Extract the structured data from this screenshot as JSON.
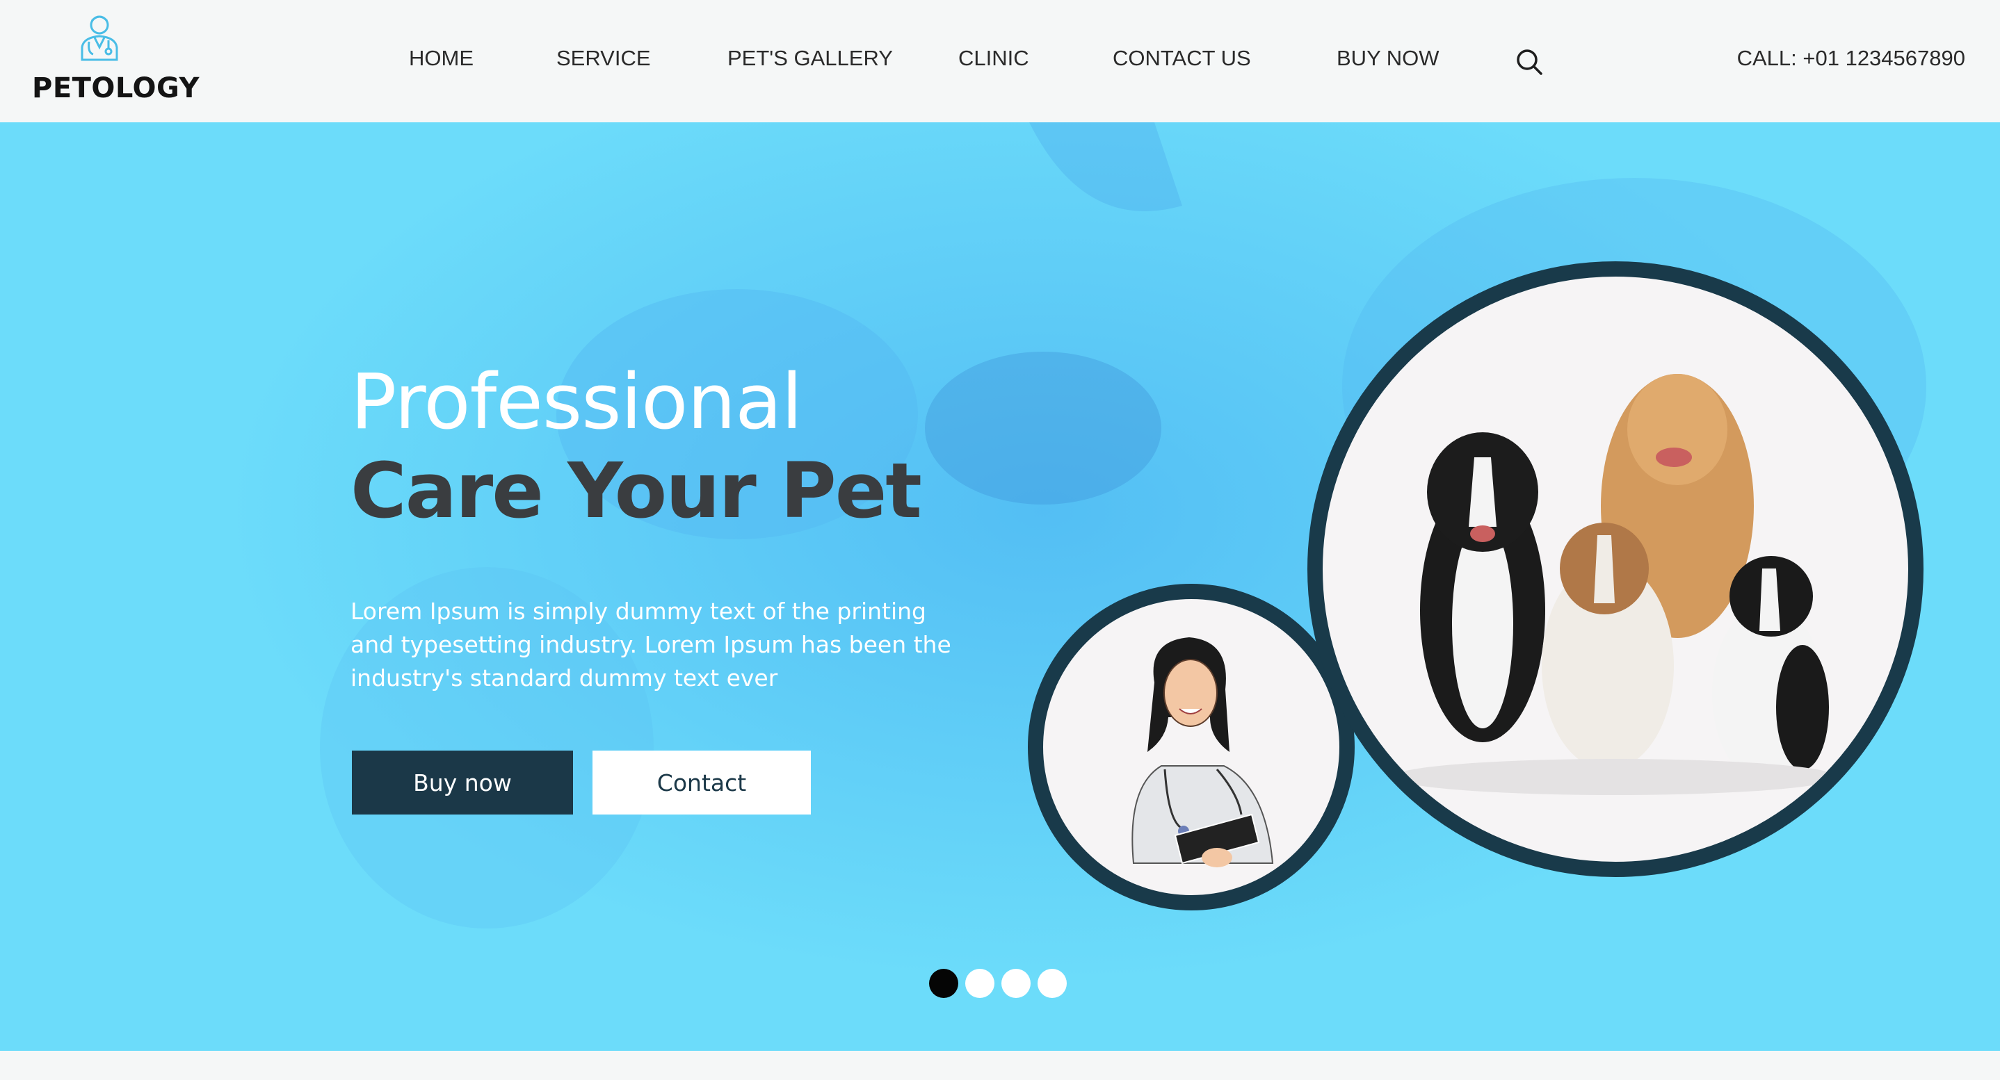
{
  "brand": {
    "name": "PETOLOGY",
    "logo_icon": "vet-doctor-icon"
  },
  "nav": {
    "items": [
      {
        "label": "HOME"
      },
      {
        "label": "SERVICE"
      },
      {
        "label": "PET'S GALLERY"
      },
      {
        "label": "CLINIC"
      },
      {
        "label": "CONTACT US"
      },
      {
        "label": "BUY NOW"
      }
    ],
    "search_icon": "search-icon",
    "call_text": "CALL: +01 1234567890"
  },
  "hero": {
    "headline_light": "Professional",
    "headline_bold": "Care Your Pet",
    "description": "Lorem Ipsum is simply dummy text of the printing and typesetting industry. Lorem Ipsum has been the industry's standard dummy text ever",
    "buy_button": "Buy now",
    "contact_button": "Contact",
    "images": [
      "dogs-photo",
      "veterinarian-illustration"
    ],
    "slides": {
      "count": 4,
      "active": 1
    }
  },
  "colors": {
    "hero_bg": "#6cdcfa",
    "accent_dark": "#1b3848",
    "header_bg": "#f5f7f7",
    "circle_border": "#193a4a"
  }
}
